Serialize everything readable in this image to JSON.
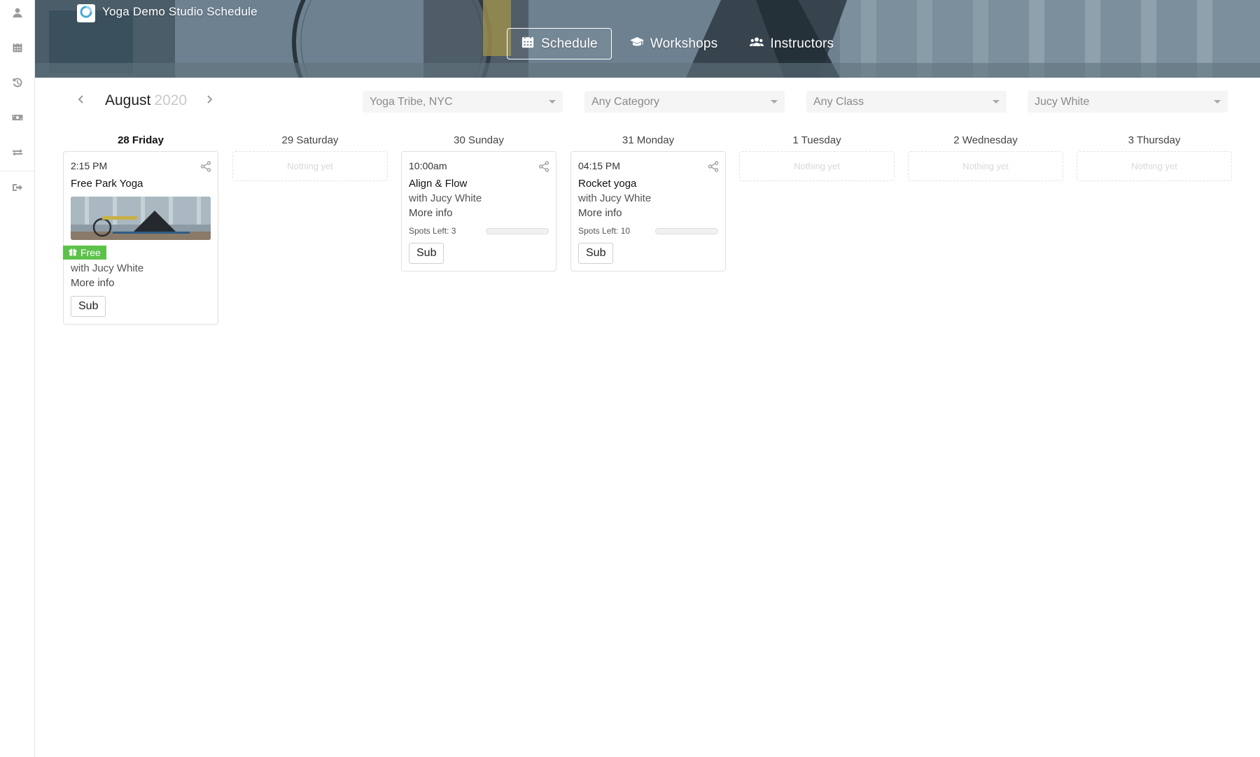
{
  "app": {
    "studio_title": "Yoga Demo Studio Schedule",
    "logo_icon": "studio-logo-icon"
  },
  "sidebar": {
    "items": [
      {
        "name": "profile",
        "icon": "user-icon"
      },
      {
        "name": "calendar",
        "icon": "calendar-icon"
      },
      {
        "name": "history",
        "icon": "history-icon"
      },
      {
        "name": "payments",
        "icon": "money-icon"
      },
      {
        "name": "transfers",
        "icon": "exchange-icon"
      },
      {
        "name": "logout",
        "icon": "sign-out-icon"
      }
    ]
  },
  "nav": {
    "tabs": [
      {
        "label": "Schedule",
        "icon": "calendar-icon",
        "active": true
      },
      {
        "label": "Workshops",
        "icon": "graduation-cap-icon",
        "active": false
      },
      {
        "label": "Instructors",
        "icon": "users-icon",
        "active": false
      }
    ]
  },
  "toolbar": {
    "month": "August",
    "year": "2020",
    "filters": [
      {
        "name": "location",
        "value": "Yoga Tribe, NYC"
      },
      {
        "name": "category",
        "value": "Any Category"
      },
      {
        "name": "class",
        "value": "Any Class"
      },
      {
        "name": "instructor",
        "value": "Jucy White"
      }
    ]
  },
  "days": [
    {
      "label": "28 Friday",
      "today": true,
      "events": [
        {
          "time": "2:15 PM",
          "name": "Free Park Yoga",
          "has_image": true,
          "badge": "Free",
          "instructor": "with Jucy White",
          "more": "More info",
          "action": "Sub"
        }
      ]
    },
    {
      "label": "29 Saturday",
      "empty_text": "Nothing yet",
      "events": []
    },
    {
      "label": "30 Sunday",
      "events": [
        {
          "time": "10:00am",
          "name": "Align & Flow",
          "instructor": "with Jucy White",
          "more": "More info",
          "spots": "Spots Left: 3",
          "spots_fill": 0.0,
          "action": "Sub"
        }
      ]
    },
    {
      "label": "31 Monday",
      "events": [
        {
          "time": "04:15 PM",
          "name": "Rocket yoga",
          "instructor": "with Jucy White",
          "more": "More info",
          "spots": "Spots Left: 10",
          "spots_fill": 0.0,
          "action": "Sub"
        }
      ]
    },
    {
      "label": "1 Tuesday",
      "empty_text": "Nothing yet",
      "events": []
    },
    {
      "label": "2 Wednesday",
      "empty_text": "Nothing yet",
      "events": []
    },
    {
      "label": "3 Thursday",
      "empty_text": "Nothing yet",
      "events": []
    }
  ],
  "colors": {
    "free_badge": "#5cc24a",
    "nav_text": "#ffffff"
  }
}
